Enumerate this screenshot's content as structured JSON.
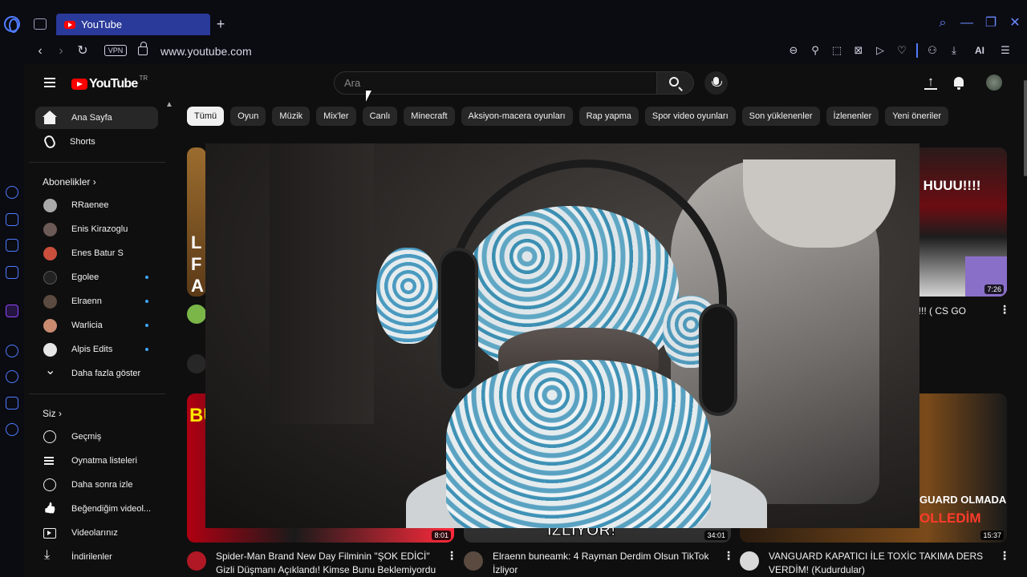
{
  "browser": {
    "tab_title": "YouTube",
    "new_tab": "+",
    "vpn": "VPN",
    "url": "www.youtube.com",
    "ai_label": "AI",
    "win_controls": [
      "⌕",
      "—",
      "❐",
      "✕"
    ],
    "toolbar_icons": [
      "zoom-out-icon",
      "pin-icon",
      "snapshot-icon",
      "adblock-icon",
      "flow-icon",
      "heart-icon",
      "account-icon",
      "download-icon",
      "ai-icon",
      "menu-icon"
    ]
  },
  "yt": {
    "logo_text": "YouTube",
    "country": "TR",
    "search_placeholder": "Ara",
    "sidebar": {
      "main": [
        {
          "label": "Ana Sayfa",
          "icon": "home-icon",
          "active": true
        },
        {
          "label": "Shorts",
          "icon": "shorts-icon"
        }
      ],
      "subs_heading": "Abonelikler",
      "subs": [
        {
          "label": "RRaenee",
          "color": "#a9a9a9"
        },
        {
          "label": "Enis Kirazoglu",
          "color": "#6b5a55"
        },
        {
          "label": "Enes Batur S",
          "color": "#c94f3c"
        },
        {
          "label": "Egolee",
          "color": "#222222",
          "dot": true
        },
        {
          "label": "Elraenn",
          "color": "#5a4a40",
          "dot": true
        },
        {
          "label": "Warlicia",
          "color": "#c98a70",
          "dot": true
        },
        {
          "label": "Alpis Edits",
          "color": "#e6e6e6",
          "dot": true
        }
      ],
      "show_more": "Daha fazla göster",
      "you_heading": "Siz",
      "you": [
        {
          "label": "Geçmiş"
        },
        {
          "label": "Oynatma listeleri"
        },
        {
          "label": "Daha sonra izle"
        },
        {
          "label": "Beğendiğim videol..."
        },
        {
          "label": "Videolarınız"
        },
        {
          "label": "İndirilenler"
        }
      ]
    },
    "chips": [
      "Tümü",
      "Oyun",
      "Müzik",
      "Mix'ler",
      "Canlı",
      "Minecraft",
      "Aksiyon-macera oyunları",
      "Rap yapma",
      "Spor video oyunları",
      "Son yüklenenler",
      "İzlenenler",
      "Yeni öneriler"
    ],
    "videos_top": [
      {
        "title": "HUUU!!! ( CS GO",
        "duration": "7:26"
      }
    ],
    "videos_bottom": [
      {
        "title_1": "Spider-Man Brand New Day Filminin \"ŞOK EDİCİ\"",
        "title_2": "Gizli Düşmanı Açıklandı! Kimse Bunu Beklemiyordu",
        "duration": "8:01"
      },
      {
        "title_1": "Elraenn buneamk: 4 Rayman Derdim Olsun TikTok",
        "title_2": "İzliyor",
        "duration": "34:01"
      },
      {
        "title_1": "VANGUARD KAPATICI İLE TOXİC TAKIMA DERS",
        "title_2": "VERDİM! (Kudurdular)",
        "duration": "15:37"
      }
    ],
    "thumb_texts": {
      "top_right": "LAR HUUU!!!!",
      "bottom_left": "BU",
      "bottom_mid": "İZLİYOR!",
      "bottom_right_1": "GUARD OLMADAN",
      "bottom_right_2": "OLLEDİM",
      "left_strip": "L F A"
    }
  }
}
